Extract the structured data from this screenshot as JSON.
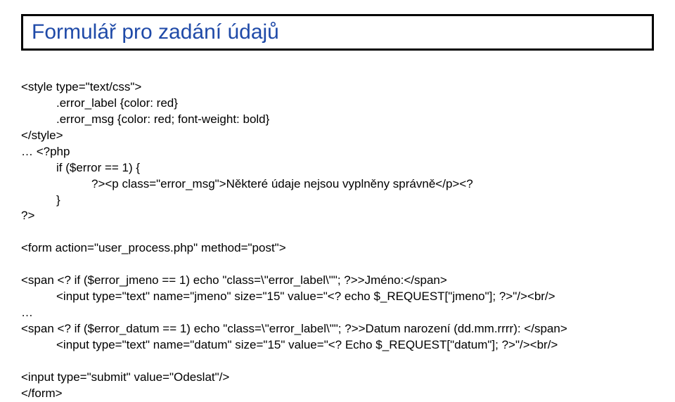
{
  "title": "Formulář pro zadání údajů",
  "code": {
    "l1": "<style type=\"text/css\">",
    "l2": ".error_label {color: red}",
    "l3": ".error_msg {color: red; font-weight: bold}",
    "l4": "</style>",
    "l5": "… <?php",
    "l6": "if ($error == 1) {",
    "l7": "?><p class=\"error_msg\">Některé údaje nejsou vyplněny správně</p><?",
    "l8": "}",
    "l9": "?>",
    "l10": "<form action=\"user_process.php\" method=\"post\">",
    "l11": "<span <? if ($error_jmeno == 1) echo \"class=\\\"error_label\\\"\"; ?>>Jméno:</span>",
    "l12": "<input type=\"text\" name=\"jmeno\" size=\"15\" value=\"<? echo $_REQUEST[\"jmeno\"]; ?>\"/><br/>",
    "l13": "…",
    "l14": "<span <? if ($error_datum == 1) echo \"class=\\\"error_label\\\"\"; ?>>Datum narození (dd.mm.rrrr): </span>",
    "l15": "<input type=\"text\" name=\"datum\" size=\"15\" value=\"<? Echo $_REQUEST[\"datum\"]; ?>\"/><br/>",
    "l16": "<input type=\"submit\" value=\"Odeslat\"/>",
    "l17": "</form>"
  }
}
